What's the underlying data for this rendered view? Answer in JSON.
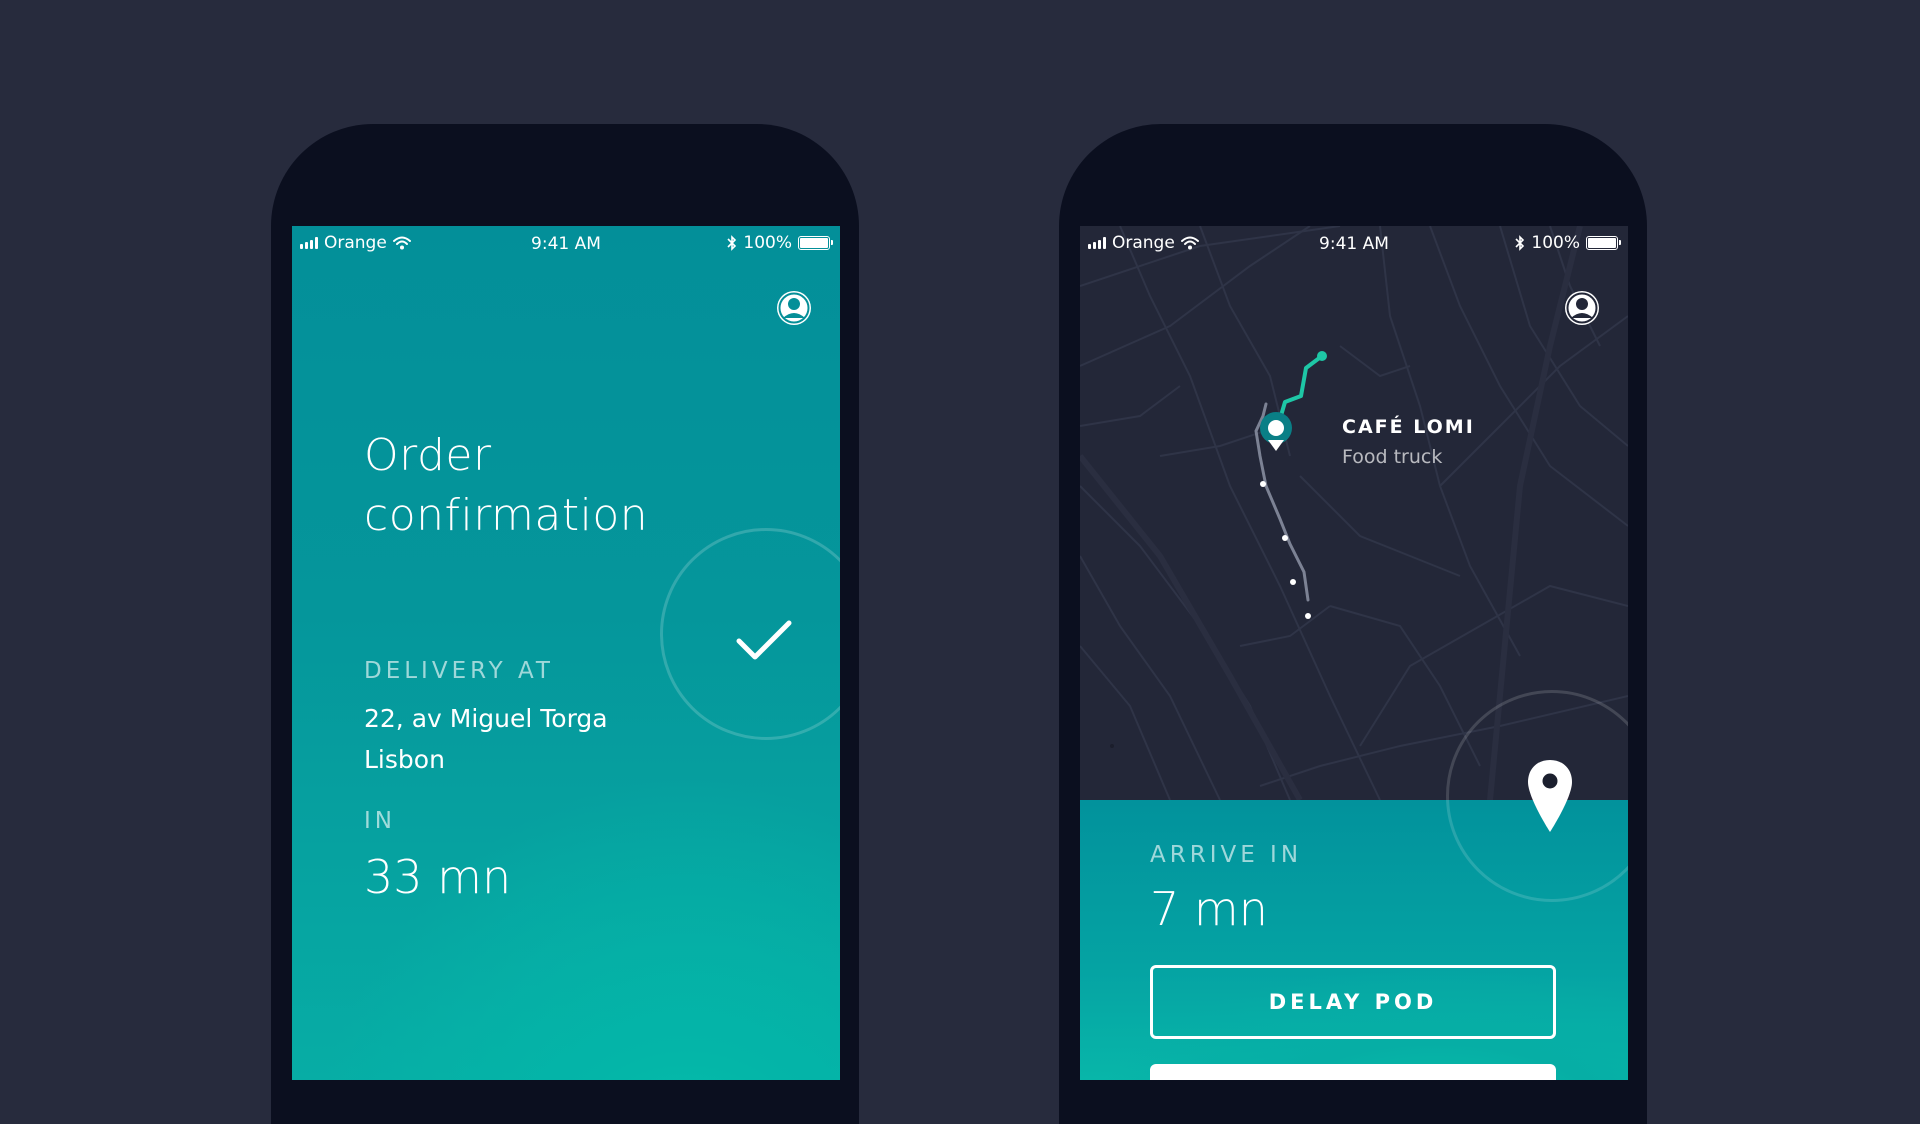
{
  "status_bar": {
    "carrier": "Orange",
    "time": "9:41 AM",
    "battery": "100%",
    "battery_level": 1.0
  },
  "left_screen": {
    "title_line1": "Order",
    "title_line2": "confirmation",
    "delivery_label": "DELIVERY AT",
    "address_line1": "22, av Miguel Torga",
    "address_line2": "Lisbon",
    "in_label": "IN",
    "eta": "33 mn"
  },
  "right_screen": {
    "place_name": "CAFÉ LOMI",
    "place_type": "Food truck",
    "arrive_label": "ARRIVE IN",
    "eta": "7 mn",
    "delay_button": "DELAY POD"
  },
  "colors": {
    "background": "#272b3d",
    "phone_body": "#0b0f1f",
    "teal_accent": "#1ec7a6",
    "map_background": "#232738"
  },
  "icons": [
    "signal-icon",
    "wifi-icon",
    "bluetooth-icon",
    "battery-icon",
    "profile-icon",
    "checkmark-icon",
    "map-pin-icon"
  ]
}
